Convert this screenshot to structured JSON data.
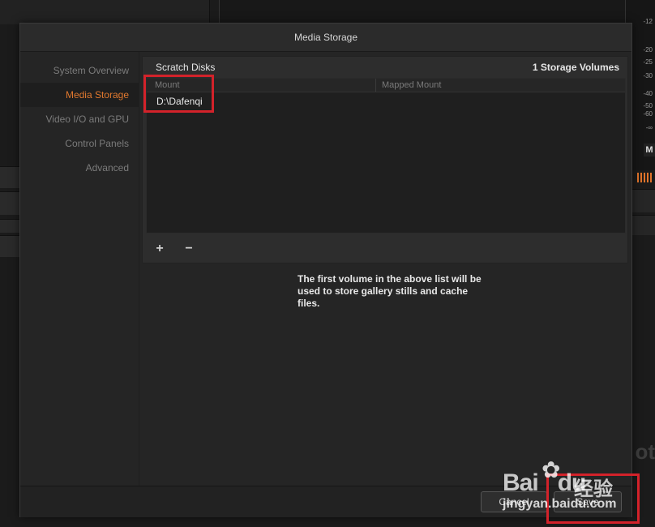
{
  "dialog": {
    "title": "Media Storage"
  },
  "sidebar": {
    "items": [
      {
        "label": "System Overview"
      },
      {
        "label": "Media Storage"
      },
      {
        "label": "Video I/O and GPU"
      },
      {
        "label": "Control Panels"
      },
      {
        "label": "Advanced"
      }
    ],
    "active_index": 1
  },
  "scratch_disks": {
    "title": "Scratch Disks",
    "volume_count": "1 Storage Volumes",
    "columns": [
      "Mount",
      "Mapped Mount"
    ],
    "rows": [
      {
        "mount": "D:\\Dafenqi",
        "mapped_mount": ""
      }
    ],
    "add_label": "+",
    "remove_label": "−"
  },
  "info": {
    "text": "The first volume in the above list will be used to store gallery stills and cache files."
  },
  "footer": {
    "cancel_label": "Cancel",
    "save_label": "Save"
  },
  "background": {
    "meter_labels": [
      "-12",
      "-20",
      "-25",
      "-30",
      "-40",
      "-50",
      "-60",
      "-∞"
    ],
    "mute_label": "M",
    "ghost_text": "ot"
  },
  "watermark": {
    "logo": "Bai",
    "logo_tail": "du",
    "chinese": "经验",
    "url": "jingyan.baidu.com"
  },
  "colors": {
    "accent": "#e0782e",
    "highlight": "#d3222a"
  }
}
